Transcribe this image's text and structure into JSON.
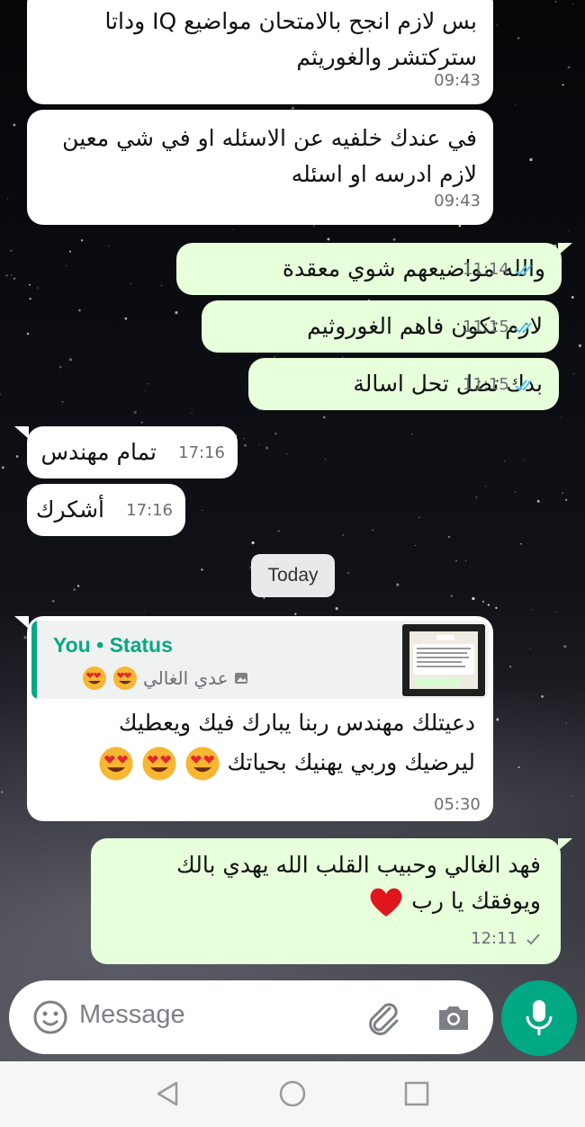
{
  "messages": [
    {
      "dir": "in",
      "text_line1": "بس لازم انجح بالامتحان مواضيع IQ وداتا",
      "text_line2": "ستركتشر والغوريثم",
      "time": "09:43"
    },
    {
      "dir": "in",
      "text_line1": "في عندك خلفيه عن الاسئله او في شي معين",
      "text_line2": "لازم ادرسه او اسئله",
      "time": "09:43"
    },
    {
      "dir": "out",
      "text": "والله مواضيعهم شوي معقدة",
      "time": "11:14",
      "status": "read"
    },
    {
      "dir": "out",
      "text": "لازم تكون فاهم الغوروثيم",
      "time": "11:15",
      "status": "read"
    },
    {
      "dir": "out",
      "text": "بدك تضل تحل اسالة",
      "time": "11:15",
      "status": "read"
    },
    {
      "dir": "in",
      "text": "تمام مهندس",
      "time": "17:16"
    },
    {
      "dir": "in",
      "text": "أشكرك",
      "time": "17:16"
    }
  ],
  "date_separator": "Today",
  "reply_message": {
    "quote_title": "You • Status",
    "quote_subtitle": "عدي الغالي",
    "text_line1": "دعيتلك مهندس ربنا يبارك فيك ويعطيك",
    "text_line2": "ليرضيك وربي يهنيك بحياتك",
    "time": "05:30"
  },
  "last_message": {
    "text_line1": "فهد الغالي وحبيب القلب الله يهدي بالك",
    "text_line2": "ويوفقك يا رب",
    "time": "12:11",
    "status": "delivered"
  },
  "input": {
    "placeholder": "Message"
  },
  "icons": {
    "emoji": "smiley-icon",
    "attach": "paperclip-icon",
    "camera": "camera-icon",
    "mic": "microphone-icon",
    "nav_back": "triangle-back-icon",
    "nav_home": "circle-home-icon",
    "nav_recents": "square-recents-icon"
  },
  "colors": {
    "outgoing_bubble": "#e7ffdb",
    "incoming_bubble": "#ffffff",
    "accent_green": "#00a884",
    "read_ticks": "#53bdeb"
  }
}
